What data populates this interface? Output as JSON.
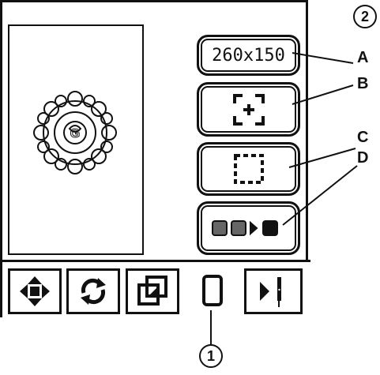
{
  "screen": {
    "hoop_size_label": "260x150"
  },
  "toolbar": {
    "icons": [
      "move-icon",
      "rotate-icon",
      "resize-icon",
      "hoop-icon",
      "stitch-out-icon"
    ]
  },
  "callouts": {
    "screen_number": "2",
    "toolbar_number": "1",
    "letters": [
      "A",
      "B",
      "C",
      "D"
    ]
  }
}
